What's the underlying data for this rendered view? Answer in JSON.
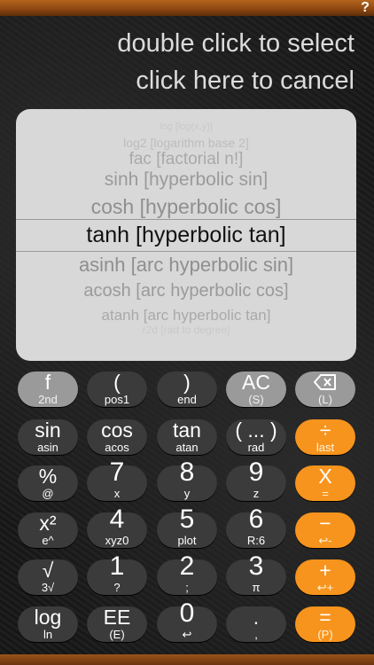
{
  "help_label": "?",
  "hint": {
    "line1": "double click to select",
    "line2": "click here to cancel"
  },
  "picker": {
    "items": [
      {
        "text": "log  [log(x,y)]"
      },
      {
        "text": "log2  [logarithm base 2]"
      },
      {
        "text": "fac  [factorial n!]"
      },
      {
        "text": "sinh  [hyperbolic sin]"
      },
      {
        "text": "cosh  [hyperbolic cos]"
      },
      {
        "text": "tanh  [hyperbolic tan]"
      },
      {
        "text": "asinh  [arc hyperbolic sin]"
      },
      {
        "text": "acosh  [arc hyperbolic cos]"
      },
      {
        "text": "atanh  [arc hyperbolic tan]"
      },
      {
        "text": "r2d  [rad to degree]"
      }
    ],
    "selected_index": 5
  },
  "keys": [
    {
      "main": "f",
      "sub": "2nd",
      "style": "gray"
    },
    {
      "main": "(",
      "sub": "pos1",
      "style": "dark"
    },
    {
      "main": ")",
      "sub": "end",
      "style": "dark"
    },
    {
      "main": "AC",
      "sub": "(S)",
      "style": "gray"
    },
    {
      "main": "",
      "sub": "(L)",
      "style": "gray",
      "icon": "backspace-icon"
    },
    {
      "main": "sin",
      "sub": "asin",
      "style": "dark"
    },
    {
      "main": "cos",
      "sub": "acos",
      "style": "dark"
    },
    {
      "main": "tan",
      "sub": "atan",
      "style": "dark"
    },
    {
      "main": "( ... )",
      "sub": "rad",
      "style": "dark"
    },
    {
      "main": "÷",
      "sub": "last",
      "style": "orange"
    },
    {
      "main": "%",
      "sub": "@",
      "style": "dark"
    },
    {
      "main": "7",
      "sub": "x",
      "style": "dark"
    },
    {
      "main": "8",
      "sub": "y",
      "style": "dark"
    },
    {
      "main": "9",
      "sub": "z",
      "style": "dark"
    },
    {
      "main": "X",
      "sub": "=",
      "style": "orange"
    },
    {
      "main": "x²",
      "sub": "e^",
      "style": "dark"
    },
    {
      "main": "4",
      "sub": "xyz0",
      "style": "dark"
    },
    {
      "main": "5",
      "sub": "plot",
      "style": "dark"
    },
    {
      "main": "6",
      "sub": "R:6",
      "style": "dark"
    },
    {
      "main": "−",
      "sub": "↩-",
      "style": "orange"
    },
    {
      "main": "√",
      "sub": "3√",
      "style": "dark"
    },
    {
      "main": "1",
      "sub": "?",
      "style": "dark"
    },
    {
      "main": "2",
      "sub": ";",
      "style": "dark"
    },
    {
      "main": "3",
      "sub": "π",
      "style": "dark"
    },
    {
      "main": "+",
      "sub": "↩+",
      "style": "orange"
    },
    {
      "main": "log",
      "sub": "ln",
      "style": "dark"
    },
    {
      "main": "EE",
      "sub": "(E)",
      "style": "dark"
    },
    {
      "main": "0",
      "sub": "↩",
      "style": "dark"
    },
    {
      "main": ".",
      "sub": ",",
      "style": "dark"
    },
    {
      "main": "=",
      "sub": "(P)",
      "style": "orange"
    }
  ]
}
